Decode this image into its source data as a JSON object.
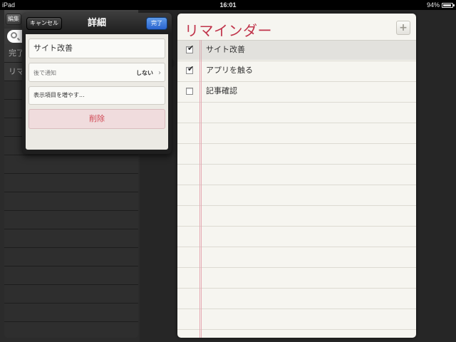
{
  "status_bar": {
    "device": "iPad",
    "time": "16:01",
    "battery": "94%"
  },
  "sidebar": {
    "edit_label": "編集",
    "items": [
      {
        "label": "完了"
      },
      {
        "label": "リマ"
      },
      {
        "label": ""
      },
      {
        "label": ""
      },
      {
        "label": ""
      },
      {
        "label": ""
      },
      {
        "label": ""
      },
      {
        "label": ""
      },
      {
        "label": ""
      },
      {
        "label": ""
      },
      {
        "label": ""
      },
      {
        "label": ""
      },
      {
        "label": ""
      },
      {
        "label": ""
      },
      {
        "label": ""
      },
      {
        "label": ""
      }
    ]
  },
  "popover": {
    "title": "詳細",
    "cancel_label": "キャンセル",
    "done_label": "完了",
    "item_title": "サイト改善",
    "remind_label": "後で通知",
    "remind_value": "しない",
    "more_label": "表示項目を増やす...",
    "delete_label": "削除"
  },
  "notepad": {
    "title": "リマインダー",
    "add_label": "+",
    "reminders": [
      {
        "text": "サイト改善",
        "checked": true,
        "selected": true
      },
      {
        "text": "アプリを触る",
        "checked": true,
        "selected": false
      },
      {
        "text": "記事確認",
        "checked": false,
        "selected": false
      }
    ]
  },
  "colors": {
    "title_red": "#c0334a",
    "done_blue": "#2a64cf",
    "delete_red": "#d14a56"
  }
}
